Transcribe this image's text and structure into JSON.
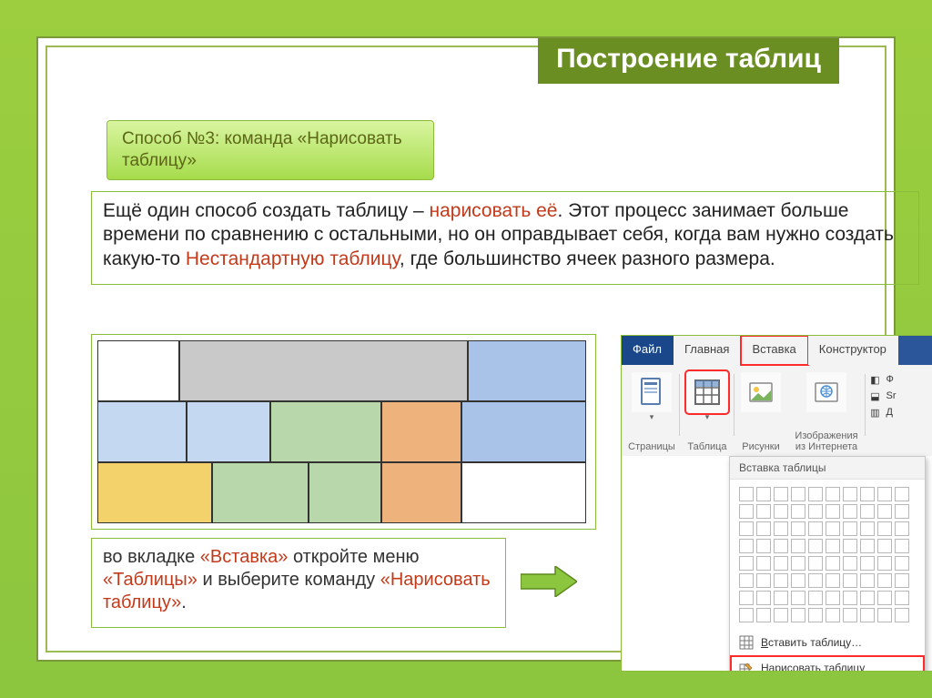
{
  "title": "Построение таблиц",
  "subtitle": "Способ №3: команда «Нарисовать таблицу»",
  "para": {
    "t1": "Ещё один способ создать таблицу – ",
    "hl1": "нарисовать её",
    "t2": ". Этот процесс занимает больше времени по сравнению с остальными, но он оправдывает себя, когда вам нужно создать какую-то ",
    "hl2": "Нестандартную таблицу",
    "t3": ", где большинство ячеек разного размера."
  },
  "instr": {
    "t1": "во вкладке ",
    "hl1": "«Вставка»",
    "t2": " откройте меню ",
    "hl2": "«Таблицы»",
    "t3": " и выберите команду ",
    "hl3": "«Нарисовать таблицу»",
    "t4": "."
  },
  "ribbon": {
    "tabs": {
      "file": "Файл",
      "home": "Главная",
      "insert": "Вставка",
      "design": "Конструктор"
    },
    "pages": "Страницы",
    "table": "Таблица",
    "pictures": "Рисунки",
    "online_images_1": "Изображения",
    "online_images_2": "из Интернета",
    "shapes_char": "Ф",
    "smartart_char": "Sr",
    "chart_char": "Д"
  },
  "dropdown": {
    "header": "Вставка таблицы",
    "insert_prefix": "В",
    "insert_rest": "ставить таблицу…",
    "draw_prefix": "Н",
    "draw_rest": "арисовать таблицу"
  }
}
